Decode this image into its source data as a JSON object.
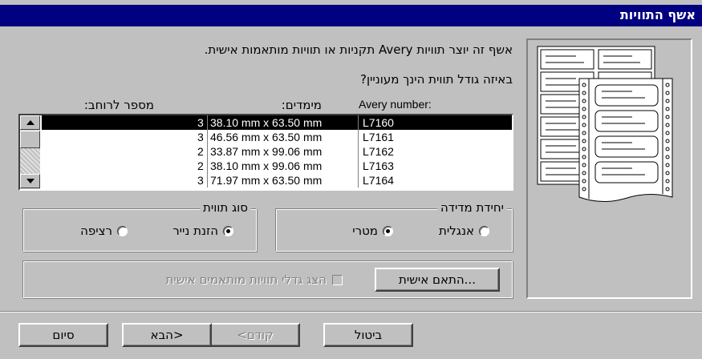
{
  "window": {
    "title": "אשף התוויות"
  },
  "intro_text": "אשף זה יוצר תוויות Avery תקניות או תוויות מותאמות אישית.",
  "question_text": "באיזה גודל תווית הינך מעוניין?",
  "columns": {
    "count": "מספר לרוחב:",
    "dimensions": "מימדים:",
    "avery": "Avery number:"
  },
  "labels": [
    {
      "count": "3",
      "size": "38.10 mm x 63.50 mm",
      "code": "L7160",
      "selected": true
    },
    {
      "count": "3",
      "size": "46.56 mm x 63.50 mm",
      "code": "L7161",
      "selected": false
    },
    {
      "count": "2",
      "size": "33.87 mm x 99.06 mm",
      "code": "L7162",
      "selected": false
    },
    {
      "count": "2",
      "size": "38.10 mm x 99.06 mm",
      "code": "L7163",
      "selected": false
    },
    {
      "count": "3",
      "size": "71.97 mm x 63.50 mm",
      "code": "L7164",
      "selected": false
    }
  ],
  "units_group": {
    "title": "יחידת מדידה",
    "options": [
      {
        "label": "אנגלית",
        "checked": false
      },
      {
        "label": "מטרי",
        "checked": true
      }
    ]
  },
  "type_group": {
    "title": "סוג תווית",
    "options": [
      {
        "label": "הזנת נייר",
        "checked": true
      },
      {
        "label": "רציפה",
        "checked": false
      }
    ]
  },
  "customize_button": "התאם אישית...",
  "show_custom_checkbox": {
    "label": "הצג גדלי תוויות מותאמים אישית",
    "checked": false
  },
  "buttons": {
    "cancel": "ביטול",
    "back": "<קודם",
    "next": "הבא>",
    "finish": "סיום"
  }
}
